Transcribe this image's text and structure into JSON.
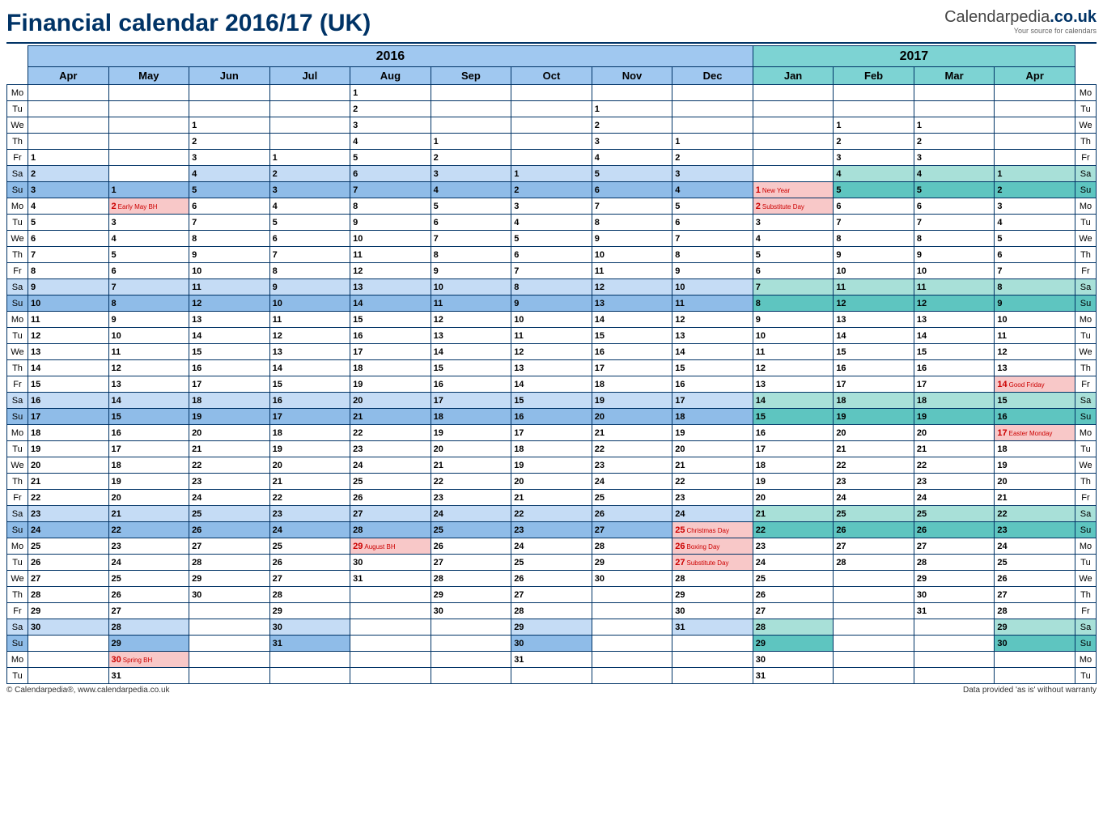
{
  "title": "Financial calendar 2016/17 (UK)",
  "brand": {
    "name": "Calendarpedia",
    "suffix": ".co.uk",
    "tagline": "Your source for calendars"
  },
  "footer": {
    "left": "© Calendarpedia®, www.calendarpedia.co.uk",
    "right": "Data provided 'as is' without warranty"
  },
  "years": {
    "y1": "2016",
    "y2": "2017"
  },
  "days": [
    "Mo",
    "Tu",
    "We",
    "Th",
    "Fr",
    "Sa",
    "Su",
    "Mo",
    "Tu",
    "We",
    "Th",
    "Fr",
    "Sa",
    "Su",
    "Mo",
    "Tu",
    "We",
    "Th",
    "Fr",
    "Sa",
    "Su",
    "Mo",
    "Tu",
    "We",
    "Th",
    "Fr",
    "Sa",
    "Su",
    "Mo",
    "Tu",
    "We",
    "Th",
    "Fr",
    "Sa",
    "Su",
    "Mo",
    "Tu"
  ],
  "months": [
    {
      "n": "Apr",
      "y": 16,
      "off": 4,
      "len": 30,
      "hol": {}
    },
    {
      "n": "May",
      "y": 16,
      "off": 6,
      "len": 31,
      "hol": {
        "2": "Early May BH",
        "30": "Spring BH"
      }
    },
    {
      "n": "Jun",
      "y": 16,
      "off": 2,
      "len": 30,
      "hol": {}
    },
    {
      "n": "Jul",
      "y": 16,
      "off": 4,
      "len": 31,
      "hol": {}
    },
    {
      "n": "Aug",
      "y": 16,
      "off": 0,
      "len": 31,
      "hol": {
        "29": "August BH"
      }
    },
    {
      "n": "Sep",
      "y": 16,
      "off": 3,
      "len": 30,
      "hol": {}
    },
    {
      "n": "Oct",
      "y": 16,
      "off": 5,
      "len": 31,
      "hol": {}
    },
    {
      "n": "Nov",
      "y": 16,
      "off": 1,
      "len": 30,
      "hol": {}
    },
    {
      "n": "Dec",
      "y": 16,
      "off": 3,
      "len": 31,
      "hol": {
        "25": "Christmas Day",
        "26": "Boxing Day",
        "27": "Substitute Day"
      }
    },
    {
      "n": "Jan",
      "y": 17,
      "off": 6,
      "len": 31,
      "hol": {
        "1": "New Year",
        "2": "Substitute Day"
      }
    },
    {
      "n": "Feb",
      "y": 17,
      "off": 2,
      "len": 28,
      "hol": {}
    },
    {
      "n": "Mar",
      "y": 17,
      "off": 2,
      "len": 31,
      "hol": {}
    },
    {
      "n": "Apr",
      "y": 17,
      "off": 5,
      "len": 30,
      "hol": {
        "14": "Good Friday",
        "17": "Easter Monday"
      }
    }
  ]
}
